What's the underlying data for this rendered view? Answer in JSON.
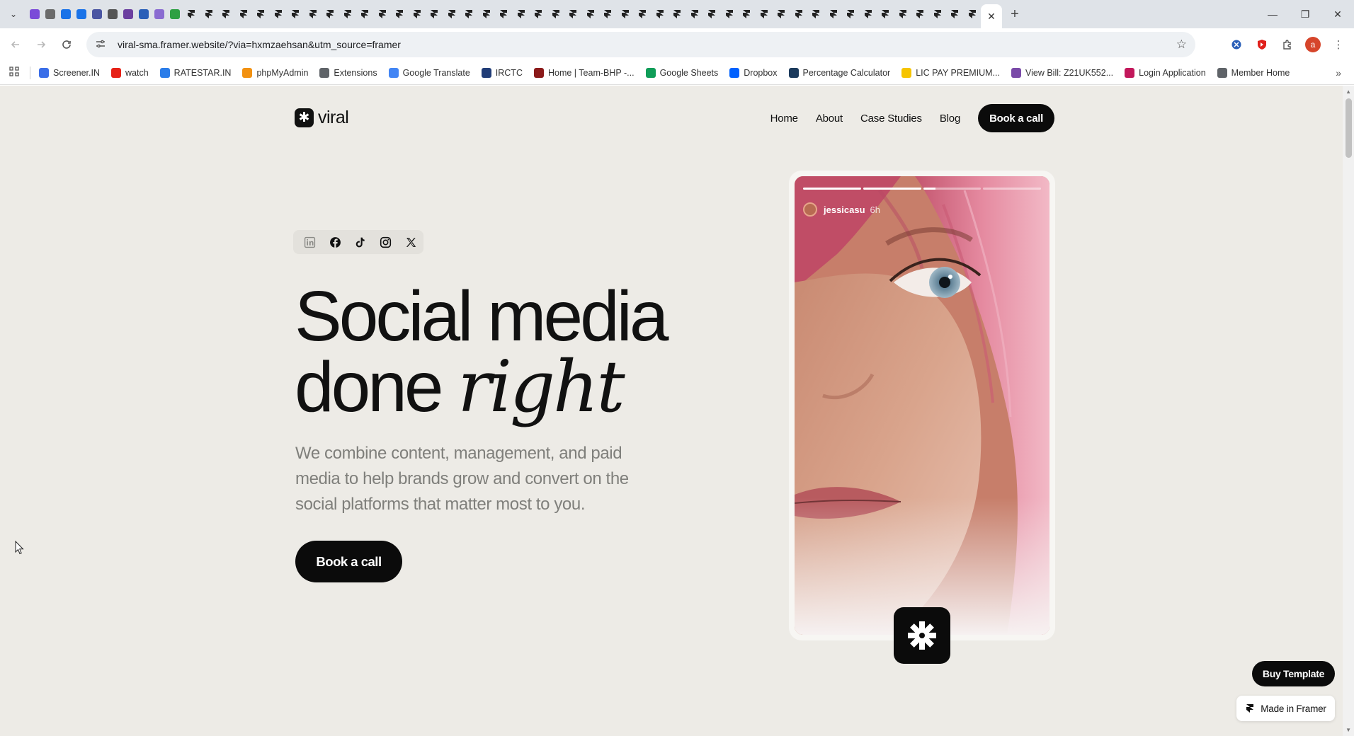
{
  "browser": {
    "active_tab_close": "✕",
    "new_tab": "+",
    "tab_search": "⌄",
    "window": {
      "minimize": "—",
      "restore": "❐",
      "close": "✕"
    },
    "url": "viral-sma.framer.website/?via=hxmzaehsan&utm_source=framer",
    "bookmark_star": "☆",
    "profile_initial": "a",
    "menu": "⋮",
    "bookmarks": [
      {
        "label": "Screener.IN",
        "color": "#3a6ee8"
      },
      {
        "label": "watch",
        "color": "#e62117"
      },
      {
        "label": "RATESTAR.IN",
        "color": "#2b7de9"
      },
      {
        "label": "phpMyAdmin",
        "color": "#f29111"
      },
      {
        "label": "Extensions",
        "color": "#5f6368"
      },
      {
        "label": "Google Translate",
        "color": "#4285f4"
      },
      {
        "label": "IRCTC",
        "color": "#213d77"
      },
      {
        "label": "Home | Team-BHP -...",
        "color": "#8b1a1a"
      },
      {
        "label": "Google Sheets",
        "color": "#0f9d58"
      },
      {
        "label": "Dropbox",
        "color": "#0061fe"
      },
      {
        "label": "Percentage Calculator",
        "color": "#1b3a5c"
      },
      {
        "label": "LIC PAY PREMIUM...",
        "color": "#f6c400"
      },
      {
        "label": "View Bill: Z21UK552...",
        "color": "#7a4aa8"
      },
      {
        "label": "Login Application",
        "color": "#c2185b"
      },
      {
        "label": "Member Home",
        "color": "#5f6368"
      }
    ],
    "bookmarks_more": "»"
  },
  "site": {
    "logo_text": "viral",
    "logo_mark": "✱",
    "nav": [
      "Home",
      "About",
      "Case Studies",
      "Blog"
    ],
    "nav_cta": "Book a call",
    "socials": [
      "linkedin-icon",
      "facebook-icon",
      "tiktok-icon",
      "instagram-icon",
      "x-icon"
    ],
    "headline_line1": "Social media",
    "headline_line2_plain": "done ",
    "headline_line2_italic": "right",
    "subcopy": "We combine content, management, and paid media to help brands grow and convert on the social platforms that matter most to you.",
    "hero_cta": "Book a call",
    "story": {
      "username": "jessicasu",
      "time": "6h",
      "progress": [
        1.0,
        1.0,
        0.22,
        0.0
      ]
    },
    "buy_template": "Buy Template",
    "made_in_framer": "Made in Framer"
  },
  "colors": {
    "page_bg": "#edebe6",
    "ink": "#111111",
    "muted": "#7f7f7b",
    "button": "#0b0b0b"
  }
}
